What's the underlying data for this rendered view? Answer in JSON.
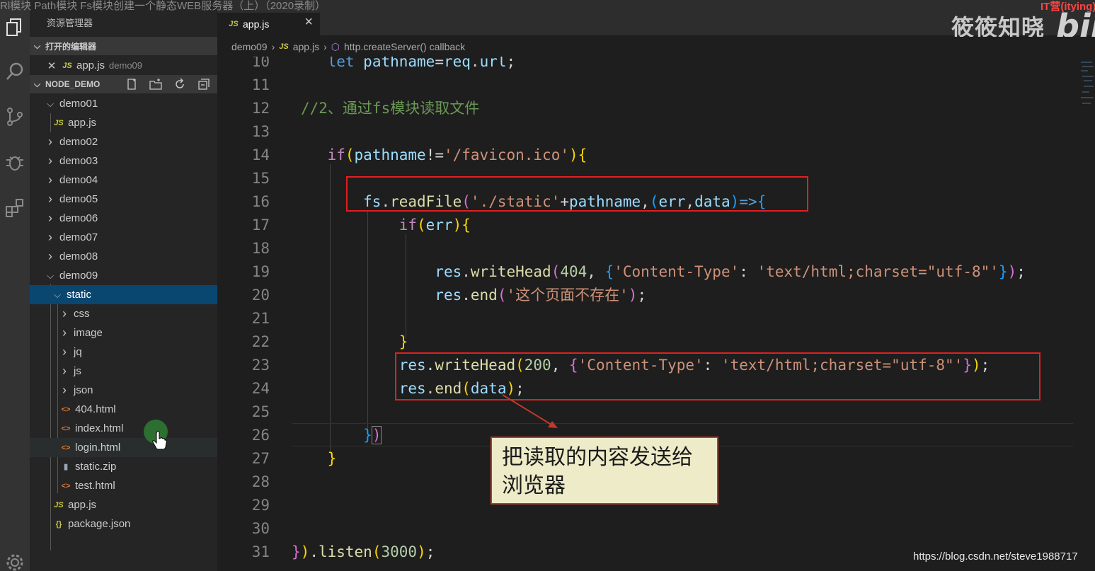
{
  "window": {
    "overlay_title": "Rl模块 Path模块 Fs模块创建一个静态WEB服务器（上）（2020录制）",
    "watermark": "筱筱知晓",
    "bili_logo": "bili",
    "bili_tag": "IT营(itying)"
  },
  "sidebar": {
    "title": "资源管理器",
    "open_editors_label": "打开的编辑器",
    "open_editor_item": {
      "name": "app.js",
      "folder": "demo09"
    },
    "project_label": "NODE_DEMO",
    "tree": [
      {
        "label": "demo01",
        "kind": "folder-open"
      },
      {
        "label": "app.js",
        "kind": "js"
      },
      {
        "label": "demo02",
        "kind": "folder"
      },
      {
        "label": "demo03",
        "kind": "folder"
      },
      {
        "label": "demo04",
        "kind": "folder"
      },
      {
        "label": "demo05",
        "kind": "folder"
      },
      {
        "label": "demo06",
        "kind": "folder"
      },
      {
        "label": "demo07",
        "kind": "folder"
      },
      {
        "label": "demo08",
        "kind": "folder"
      },
      {
        "label": "demo09",
        "kind": "folder-open"
      },
      {
        "label": "static",
        "kind": "folder-open"
      },
      {
        "label": "css",
        "kind": "folder"
      },
      {
        "label": "image",
        "kind": "folder"
      },
      {
        "label": "jq",
        "kind": "folder"
      },
      {
        "label": "js",
        "kind": "folder"
      },
      {
        "label": "json",
        "kind": "folder"
      },
      {
        "label": "404.html",
        "kind": "html"
      },
      {
        "label": "index.html",
        "kind": "html"
      },
      {
        "label": "login.html",
        "kind": "html"
      },
      {
        "label": "static.zip",
        "kind": "zip"
      },
      {
        "label": "test.html",
        "kind": "html"
      },
      {
        "label": "app.js",
        "kind": "js"
      },
      {
        "label": "package.json",
        "kind": "json"
      }
    ]
  },
  "tab": {
    "label": "app.js",
    "icon": "JS",
    "close": "×"
  },
  "breadcrumb": {
    "folder": "demo09",
    "file": "app.js",
    "symbol": "http.createServer() callback"
  },
  "icons": {
    "js": "JS",
    "html": "<>",
    "json": "{}",
    "zip": "▮"
  },
  "editor": {
    "line_numbers": [
      "10",
      "11",
      "12",
      "13",
      "14",
      "15",
      "16",
      "17",
      "18",
      "19",
      "20",
      "21",
      "22",
      "23",
      "24",
      "25",
      "26",
      "27",
      "28",
      "29",
      "30",
      "31"
    ],
    "lines": {
      "l10": {
        "a": "let",
        "b": "pathname",
        "c": "=",
        "d": "req",
        "e": ".",
        "f": "url",
        "g": ";"
      },
      "l12": "//2、通过fs模块读取文件",
      "l14": {
        "a": "if",
        "b": "(",
        "c": "pathname",
        "d": "!=",
        "e": "'/favicon.ico'",
        "f": ")",
        "g": "{"
      },
      "l16": {
        "a": "fs",
        "b": ".",
        "c": "readFile",
        "d": "(",
        "e": "'./static'",
        "f": "+",
        "g": "pathname",
        "h": ",",
        "i": "(",
        "j": "err",
        "k": ",",
        "l": "data",
        "m": ")",
        "n": "=>",
        "o": "{"
      },
      "l17": {
        "a": "if",
        "b": "(",
        "c": "err",
        "d": ")",
        "e": "{"
      },
      "l19": {
        "a": "res",
        "b": ".",
        "c": "writeHead",
        "d": "(",
        "e": "404",
        "f": ", ",
        "g": "{",
        "h": "'Content-Type'",
        "i": ": ",
        "j": "'text/html;charset=\"utf-8\"'",
        "k": "}",
        "l": ")",
        "m": ";"
      },
      "l20": {
        "a": "res",
        "b": ".",
        "c": "end",
        "d": "(",
        "e": "'这个页面不存在'",
        "f": ")",
        "g": ";"
      },
      "l22": "}",
      "l23": {
        "a": "res",
        "b": ".",
        "c": "writeHead",
        "d": "(",
        "e": "200",
        "f": ", ",
        "g": "{",
        "h": "'Content-Type'",
        "i": ": ",
        "j": "'text/html;charset=\"utf-8\"'",
        "k": "}",
        "l": ")",
        "m": ";"
      },
      "l24": {
        "a": "res",
        "b": ".",
        "c": "end",
        "d": "(",
        "e": "data",
        "f": ")",
        "g": ";"
      },
      "l26": {
        "a": "}",
        "b": ")"
      },
      "l27": "}",
      "l31": {
        "a": "}",
        "b": ")",
        "c": ".",
        "d": "listen",
        "e": "(",
        "f": "3000",
        "g": ")",
        "h": ";"
      }
    }
  },
  "callout": {
    "line1": "把读取的内容发送给",
    "line2": "浏览器"
  },
  "credit": "https://blog.csdn.net/steve1988717",
  "colors": {
    "annotation_red": "#e02020",
    "selection": "#094771",
    "callout_bg": "#eeecc8"
  }
}
